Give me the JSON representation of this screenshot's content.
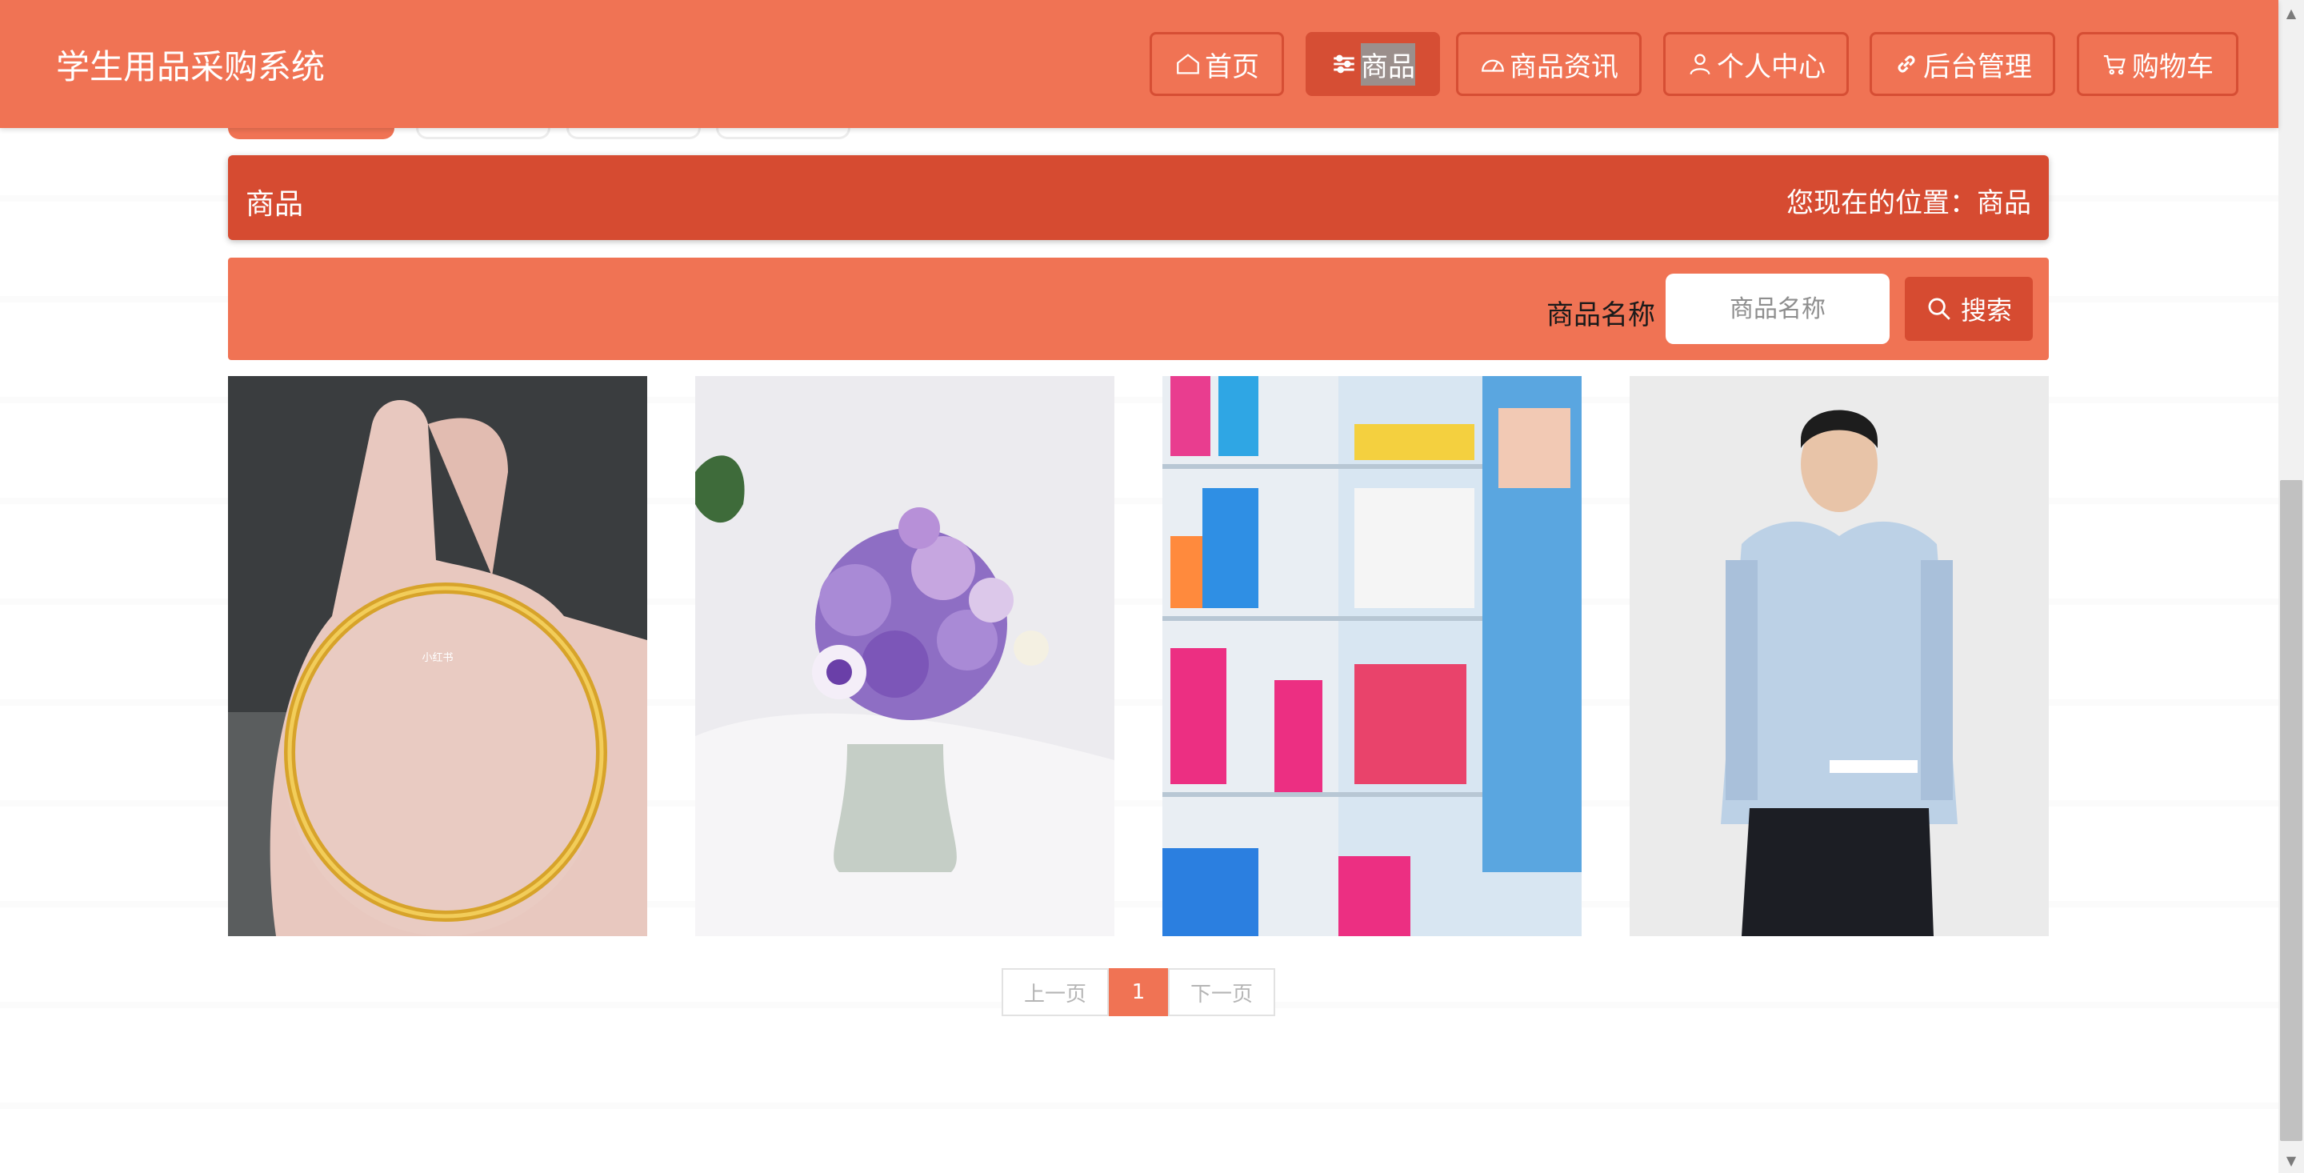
{
  "app": {
    "title": "学生用品采购系统"
  },
  "nav": [
    {
      "label": "首页",
      "icon": "home-icon"
    },
    {
      "label": "商品",
      "icon": "sliders-icon",
      "active": true
    },
    {
      "label": "商品资讯",
      "icon": "gauge-icon"
    },
    {
      "label": "个人中心",
      "icon": "user-icon"
    },
    {
      "label": "后台管理",
      "icon": "link-icon"
    },
    {
      "label": "购物车",
      "icon": "cart-icon"
    }
  ],
  "breadcrumb": {
    "title": "商品",
    "location": "您现在的位置：商品"
  },
  "search": {
    "label": "商品名称",
    "placeholder": "商品名称",
    "value": "",
    "button": "搜索",
    "icon": "search-icon"
  },
  "products": [
    {
      "image": "gold-bangle-in-hand",
      "overlay_text": "小红书"
    },
    {
      "image": "purple-flower-bouquet"
    },
    {
      "image": "plastic-baskets-shelf"
    },
    {
      "image": "man-in-blue-shirt"
    }
  ],
  "pagination": {
    "prev": "上一页",
    "current": "1",
    "next": "下一页"
  },
  "colors": {
    "header": "#f07354",
    "accent": "#d64b31",
    "button_border": "#d64e34"
  }
}
